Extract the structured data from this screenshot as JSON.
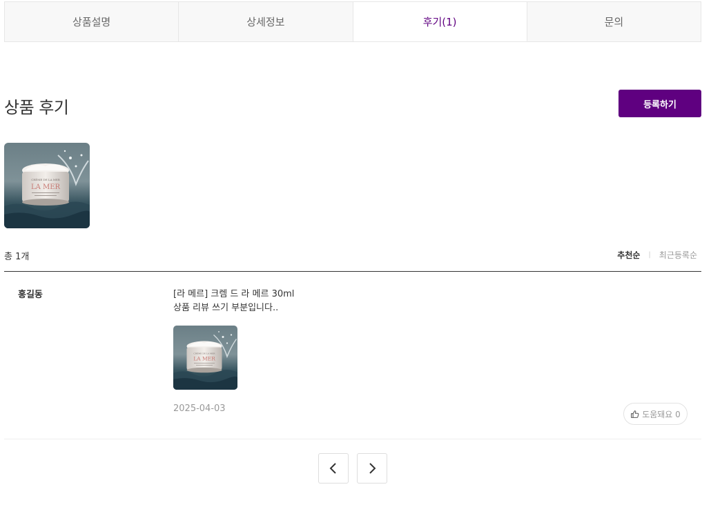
{
  "tabs": [
    {
      "label": "상품설명"
    },
    {
      "label": "상세정보"
    },
    {
      "label": "후기(1)"
    },
    {
      "label": "문의"
    }
  ],
  "active_tab_index": 2,
  "reviews_section": {
    "title": "상품 후기",
    "register_button": "등록하기",
    "total_count": "총 1개",
    "sort": {
      "recommended": "추천순",
      "separator": "|",
      "latest": "최근등록순"
    }
  },
  "photo_strip": [
    {
      "icon": "product-photo-lamer-cream"
    }
  ],
  "reviews": [
    {
      "author": "홍길동",
      "product_name": "[라 메르] 크렘 드 라 메르 30ml",
      "content": "상품 리뷰 쓰기 부분입니다..",
      "date": "2025-04-03",
      "helpful_label": "도움돼요 0",
      "photo_icon": "product-photo-lamer-cream"
    }
  ],
  "pagination": {
    "prev_icon": "chevron-left-icon",
    "next_icon": "chevron-right-icon"
  },
  "colors": {
    "accent": "#5f0080",
    "text": "#333333",
    "muted": "#999999",
    "border": "#e6e6e6"
  }
}
